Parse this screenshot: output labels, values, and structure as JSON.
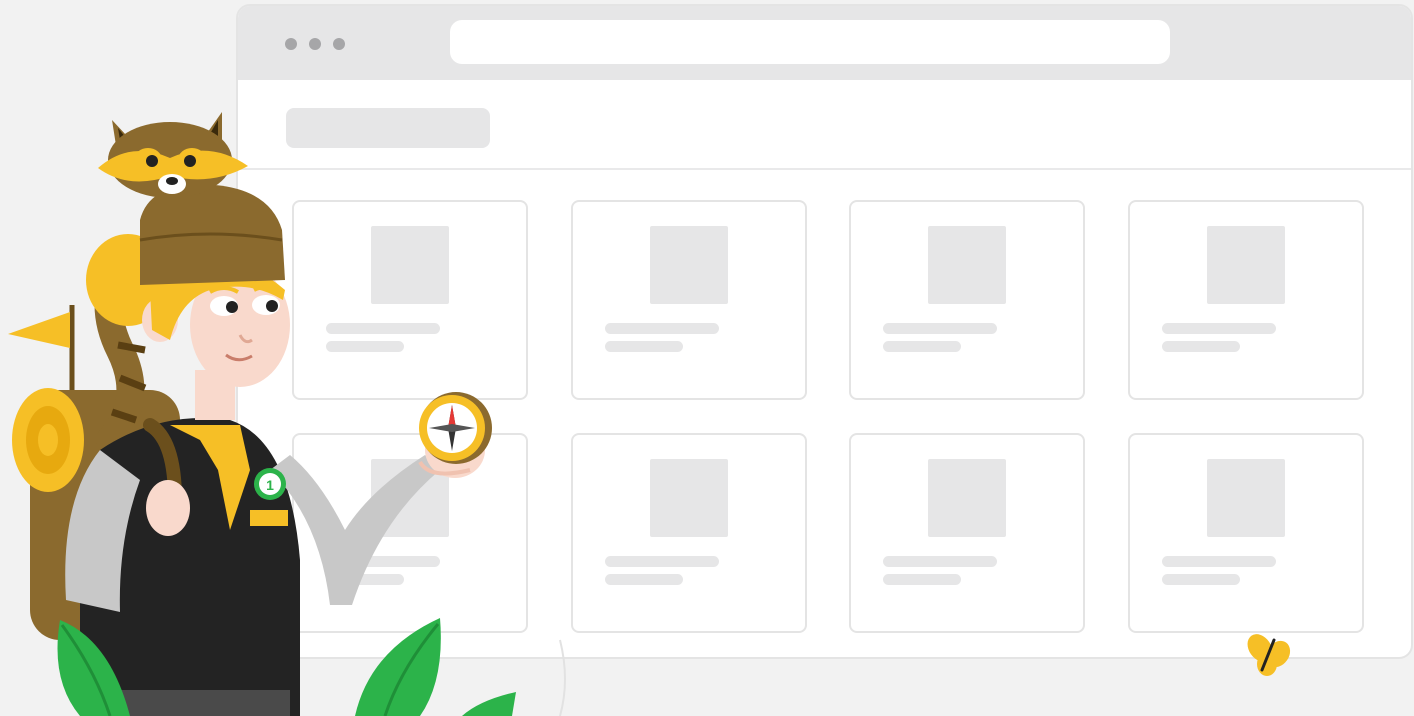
{
  "colors": {
    "background": "#f2f2f2",
    "browser_chrome": "#e6e6e7",
    "placeholder": "#e6e6e7",
    "accent_yellow": "#f6bf26",
    "brand_green": "#2cb34a",
    "hat_brown": "#8b6a2e"
  },
  "browser": {
    "window_dots": [
      "dot",
      "dot",
      "dot"
    ],
    "card_count": 8
  },
  "illustration": {
    "subject": "ranger-with-raccoon-and-compass",
    "badge_text": "1"
  }
}
